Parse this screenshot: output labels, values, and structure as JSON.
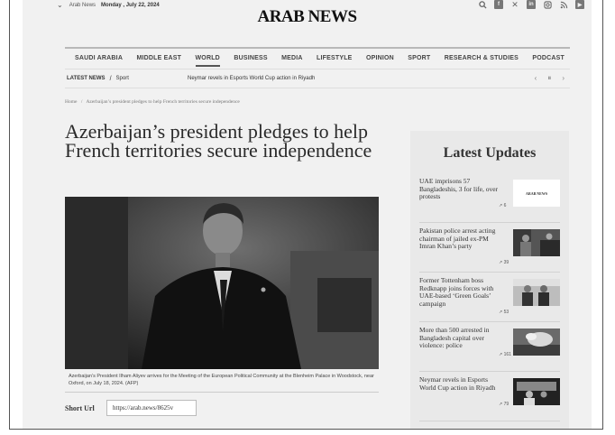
{
  "topbar": {
    "site_small": "Arab News",
    "date": "Monday , July 22, 2024",
    "logo": "ARAB NEWS",
    "social_icons": [
      "search-icon",
      "facebook-icon",
      "x-icon",
      "linkedin-icon",
      "instagram-icon",
      "rss-icon",
      "youtube-icon"
    ]
  },
  "nav": {
    "items": [
      "SAUDI ARABIA",
      "MIDDLE EAST",
      "WORLD",
      "BUSINESS",
      "MEDIA",
      "LIFESTYLE",
      "OPINION",
      "SPORT",
      "RESEARCH & STUDIES",
      "PODCAST"
    ],
    "active": "WORLD"
  },
  "subnav": {
    "latest": "LATEST NEWS",
    "slash": "/",
    "section": "Sport",
    "ticker": "Neymar revels in Esports World Cup action in Riyadh",
    "prev": "‹",
    "pause": "⏸",
    "next": "›"
  },
  "breadcrumb": {
    "home": "Home",
    "sep": "/",
    "current": "Azerbaijan’s president pledges to help French territories secure independence"
  },
  "article": {
    "headline": "Azerbaijan’s president pledges to help French territories secure independence",
    "caption": "Azerbaijan’s President Ilham Aliyev arrives for the Meeting of the European Political Community at the Blenheim Palace in Woodstock, near Oxford, on July 18, 2024. (AFP)",
    "short_url_label": "Short Url",
    "short_url": "https://arab.news/8625v"
  },
  "sidebar": {
    "title": "Latest Updates",
    "items": [
      {
        "title": "UAE imprisons 57 Bangladeshis, 3 for life, over protests",
        "trend": "6",
        "thumb_text": "ARAB NEWS"
      },
      {
        "title": "Pakistan police arrest acting chairman of jailed ex-PM Imran Khan’s party",
        "trend": "39"
      },
      {
        "title": "Former Tottenham boss Redknapp joins forces with UAE-based ‘Green Goals’ campaign",
        "trend": "53"
      },
      {
        "title": "More than 500 arrested in Bangladesh capital over violence: police",
        "trend": "161"
      },
      {
        "title": "Neymar revels in Esports World Cup action in Riyadh",
        "trend": "79"
      }
    ]
  },
  "colors": {
    "background": "#f1f1f1",
    "sidebar": "#e9e9e9",
    "text": "#222222",
    "accent": "#555555"
  }
}
